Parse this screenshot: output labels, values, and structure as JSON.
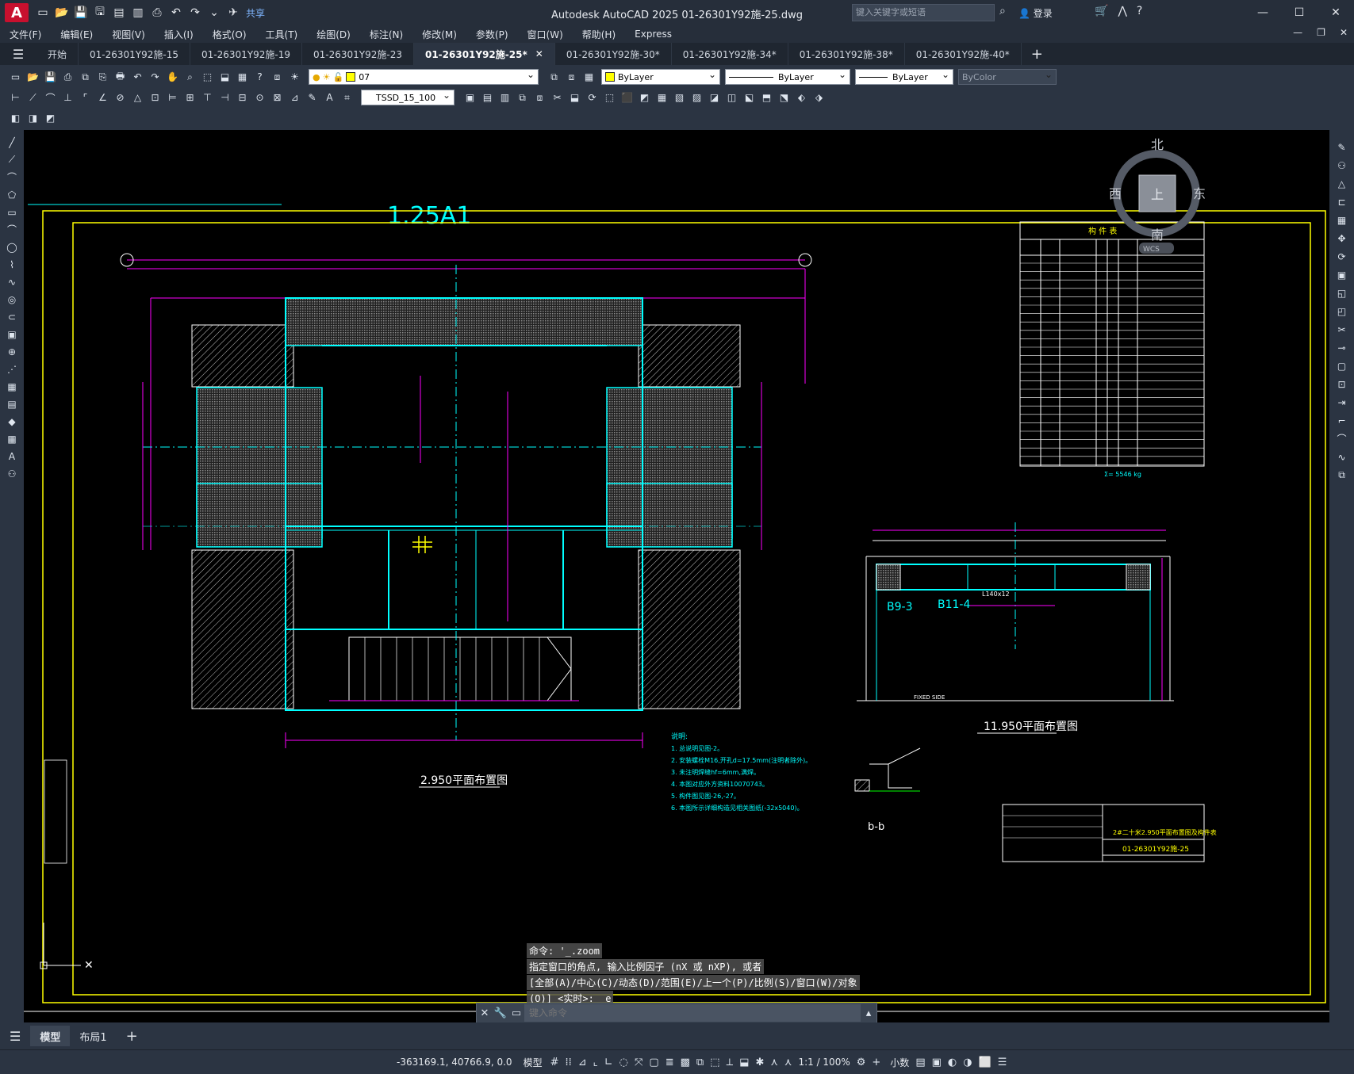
{
  "app": {
    "title": "Autodesk AutoCAD 2025    01-26301Y92施-25.dwg",
    "share_label": "共享",
    "search_placeholder": "键入关键字或短语",
    "login_label": "登录"
  },
  "menu": [
    "文件(F)",
    "编辑(E)",
    "视图(V)",
    "插入(I)",
    "格式(O)",
    "工具(T)",
    "绘图(D)",
    "标注(N)",
    "修改(M)",
    "参数(P)",
    "窗口(W)",
    "帮助(H)",
    "Express"
  ],
  "tabs": [
    {
      "label": "开始",
      "active": false
    },
    {
      "label": "01-26301Y92施-15",
      "active": false
    },
    {
      "label": "01-26301Y92施-19",
      "active": false
    },
    {
      "label": "01-26301Y92施-23",
      "active": false
    },
    {
      "label": "01-26301Y92施-25*",
      "active": true
    },
    {
      "label": "01-26301Y92施-30*",
      "active": false
    },
    {
      "label": "01-26301Y92施-34*",
      "active": false
    },
    {
      "label": "01-26301Y92施-38*",
      "active": false
    },
    {
      "label": "01-26301Y92施-40*",
      "active": false
    }
  ],
  "properties": {
    "layer": "07",
    "color": "ByLayer",
    "linetype": "ByLayer",
    "lineweight": "ByLayer",
    "plotstyle": "ByColor",
    "dimstyle": "TSSD_15_100"
  },
  "viewcube": {
    "north": "北",
    "south": "南",
    "east": "东",
    "west": "西",
    "face": "上",
    "ucs": "WCS"
  },
  "drawing": {
    "sheet_title": "1.25A1",
    "plan_main_title": "2.950平面布置图",
    "plan_side_title": "11.950平面布置图",
    "section_title": "b-b",
    "side_labels": [
      "B9-3",
      "B11-4"
    ],
    "side_member": "L140x12",
    "fixed_side": "FIXED SIDE",
    "table_title": "构   件   表",
    "total_weight": "Σ= 5546 kg",
    "drawing_no": "01-26301Y92施-25",
    "title_block_name": "2#二十米2.950平面布置图及构件表",
    "notes_title": "说明:",
    "notes": [
      "1. 总说明见图-2。",
      "2. 安装螺栓M16,开孔d=17.5mm(注明者除外)。",
      "3. 未注明焊缝hf=6mm,满焊。",
      "4. 本图对应外方资料10070743。",
      "5. 构件图见图-26,-27。",
      "6. 本图所示详细构造见相关图纸(-32x5040)。"
    ]
  },
  "command": {
    "history": [
      "命令: '_.zoom",
      "指定窗口的角点, 输入比例因子 (nX 或 nXP), 或者",
      "[全部(A)/中心(C)/动态(D)/范围(E)/上一个(P)/比例(S)/窗口(W)/对象",
      "(O)] <实时>: _e"
    ],
    "placeholder": "键入命令"
  },
  "layouts": [
    {
      "label": "模型",
      "active": true
    },
    {
      "label": "布局1",
      "active": false
    }
  ],
  "status": {
    "coords": "-363169.1, 40766.9, 0.0",
    "model": "模型",
    "scale": "1:1 / 100%",
    "units": "小数"
  }
}
